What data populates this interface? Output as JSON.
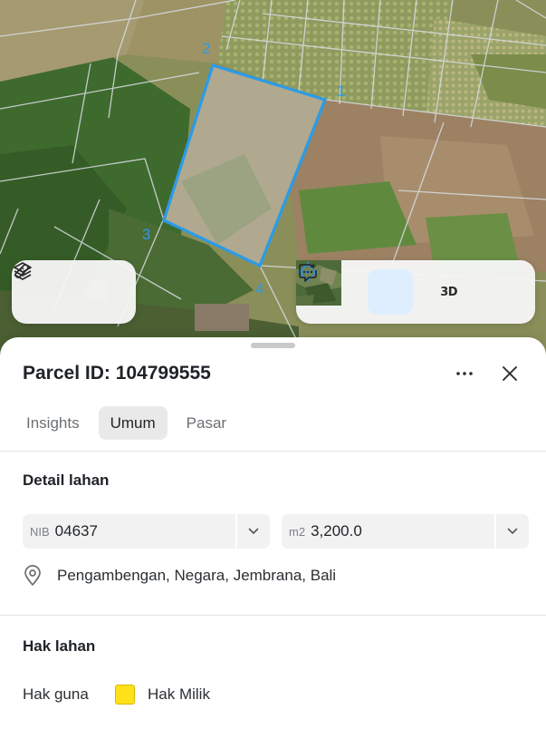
{
  "map": {
    "parcel_points": [
      "1",
      "2",
      "3",
      "4"
    ],
    "parcel_color": "#2b9be8",
    "controls_left": [
      {
        "name": "layers-icon"
      },
      {
        "name": "measure-icon"
      }
    ],
    "controls_right": {
      "basemap": "satellite-thumbnail",
      "locate": "crosshair-icon",
      "three_d_label": "3D",
      "feedback": "chat-icon"
    }
  },
  "sheet": {
    "title": "Parcel ID: 104799555",
    "tabs": [
      {
        "label": "Insights",
        "active": false
      },
      {
        "label": "Umum",
        "active": true
      },
      {
        "label": "Pasar",
        "active": false
      }
    ],
    "detail": {
      "title": "Detail lahan",
      "nib_prefix": "NIB",
      "nib_value": "04637",
      "area_prefix": "m2",
      "area_value": "3,200.0",
      "location": "Pengambengan, Negara, Jembrana, Bali"
    },
    "rights": {
      "title": "Hak lahan",
      "label": "Hak guna",
      "value": "Hak Milik",
      "swatch_color": "#ffe11a"
    }
  }
}
